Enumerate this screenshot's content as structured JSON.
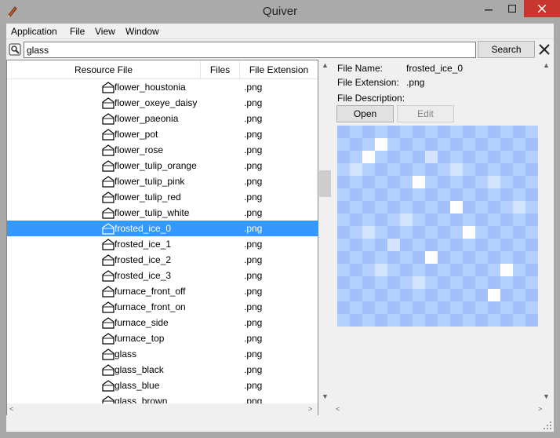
{
  "window": {
    "title": "Quiver",
    "app_icon": "pencil-icon",
    "controls": [
      "minimize-icon",
      "maximize-icon",
      "close-icon"
    ],
    "close_color": "#c7372f"
  },
  "menu": [
    "Application",
    "File",
    "View",
    "Window"
  ],
  "search": {
    "value": "glass",
    "button_label": "Search",
    "icon": "search-icon",
    "clear_icon": "close-icon"
  },
  "table": {
    "columns": [
      "Resource File",
      "Files",
      "File Extension"
    ],
    "rows": [
      {
        "name": "flower_houstonia",
        "ext": ".png"
      },
      {
        "name": "flower_oxeye_daisy",
        "ext": ".png"
      },
      {
        "name": "flower_paeonia",
        "ext": ".png"
      },
      {
        "name": "flower_pot",
        "ext": ".png"
      },
      {
        "name": "flower_rose",
        "ext": ".png"
      },
      {
        "name": "flower_tulip_orange",
        "ext": ".png"
      },
      {
        "name": "flower_tulip_pink",
        "ext": ".png"
      },
      {
        "name": "flower_tulip_red",
        "ext": ".png"
      },
      {
        "name": "flower_tulip_white",
        "ext": ".png"
      },
      {
        "name": "frosted_ice_0",
        "ext": ".png",
        "selected": true
      },
      {
        "name": "frosted_ice_1",
        "ext": ".png"
      },
      {
        "name": "frosted_ice_2",
        "ext": ".png"
      },
      {
        "name": "frosted_ice_3",
        "ext": ".png"
      },
      {
        "name": "furnace_front_off",
        "ext": ".png"
      },
      {
        "name": "furnace_front_on",
        "ext": ".png"
      },
      {
        "name": "furnace_side",
        "ext": ".png"
      },
      {
        "name": "furnace_top",
        "ext": ".png"
      },
      {
        "name": "glass",
        "ext": ".png"
      },
      {
        "name": "glass_black",
        "ext": ".png"
      },
      {
        "name": "glass_blue",
        "ext": ".png"
      },
      {
        "name": "glass_brown",
        "ext": ".png"
      }
    ],
    "row_icon": "house-icon",
    "selected_color": "#3399ff"
  },
  "details": {
    "file_name_label": "File Name:",
    "file_name": "frosted_ice_0",
    "file_ext_label": "File Extension:",
    "file_ext": ".png",
    "file_desc_label": "File Description:",
    "open_label": "Open",
    "edit_label": "Edit",
    "preview_colors": [
      "#a4c0fb",
      "#b4d0fd",
      "#d4e4ff",
      "#ffffff"
    ]
  }
}
